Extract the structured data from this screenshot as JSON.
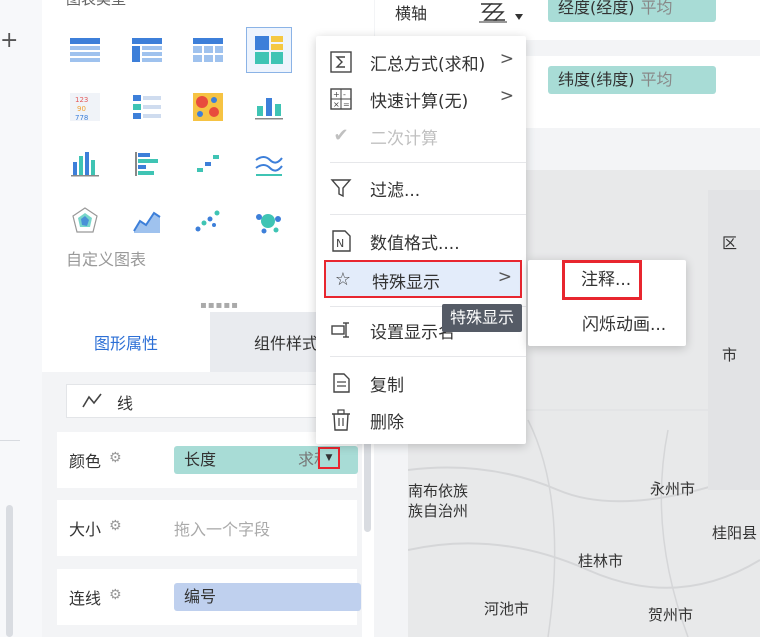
{
  "chart_panel": {
    "title": "图表类型",
    "custom_label": "自定义图表"
  },
  "tabs": {
    "graphic": "图形属性",
    "style": "组件样式"
  },
  "properties": {
    "mark_type": "线",
    "color": {
      "label": "颜色",
      "field": "长度",
      "agg": "求和"
    },
    "size": {
      "label": "大小",
      "placeholder": "拖入一个字段"
    },
    "connect": {
      "label": "连线",
      "field": "编号"
    }
  },
  "axes": {
    "x_label": "横轴",
    "x_field": "经度(经度)",
    "x_agg": "平均",
    "y_field": "纬度(纬度)",
    "y_agg": "平均"
  },
  "menu": {
    "items": [
      {
        "label": "汇总方式(求和)",
        "icon": "sigma-icon"
      },
      {
        "label": "快速计算(无)",
        "icon": "calculator-icon"
      },
      {
        "label": "二次计算",
        "icon": "check-icon"
      },
      {
        "label": "过滤...",
        "icon": "filter-icon"
      },
      {
        "label": "数值格式....",
        "icon": "number-format-icon"
      },
      {
        "label": "特殊显示",
        "icon": "star-icon"
      },
      {
        "label": "设置显示名",
        "icon": "rename-icon"
      },
      {
        "label": "复制",
        "icon": "copy-icon"
      },
      {
        "label": "删除",
        "icon": "trash-icon"
      }
    ]
  },
  "submenu": {
    "annotation": "注释...",
    "flash": "闪烁动画..."
  },
  "tooltip": "特殊显示",
  "map": {
    "labels": [
      "区",
      "市",
      "南布依族",
      "族自治州",
      "永州市",
      "桂阳县",
      "桂林市",
      "河池市",
      "贺州市"
    ]
  },
  "colors": {
    "accent": "#2c6fd6",
    "teal_pill": "#a8dcd6",
    "blue_pill": "#bfd0ee",
    "highlight": "#e8262f"
  }
}
